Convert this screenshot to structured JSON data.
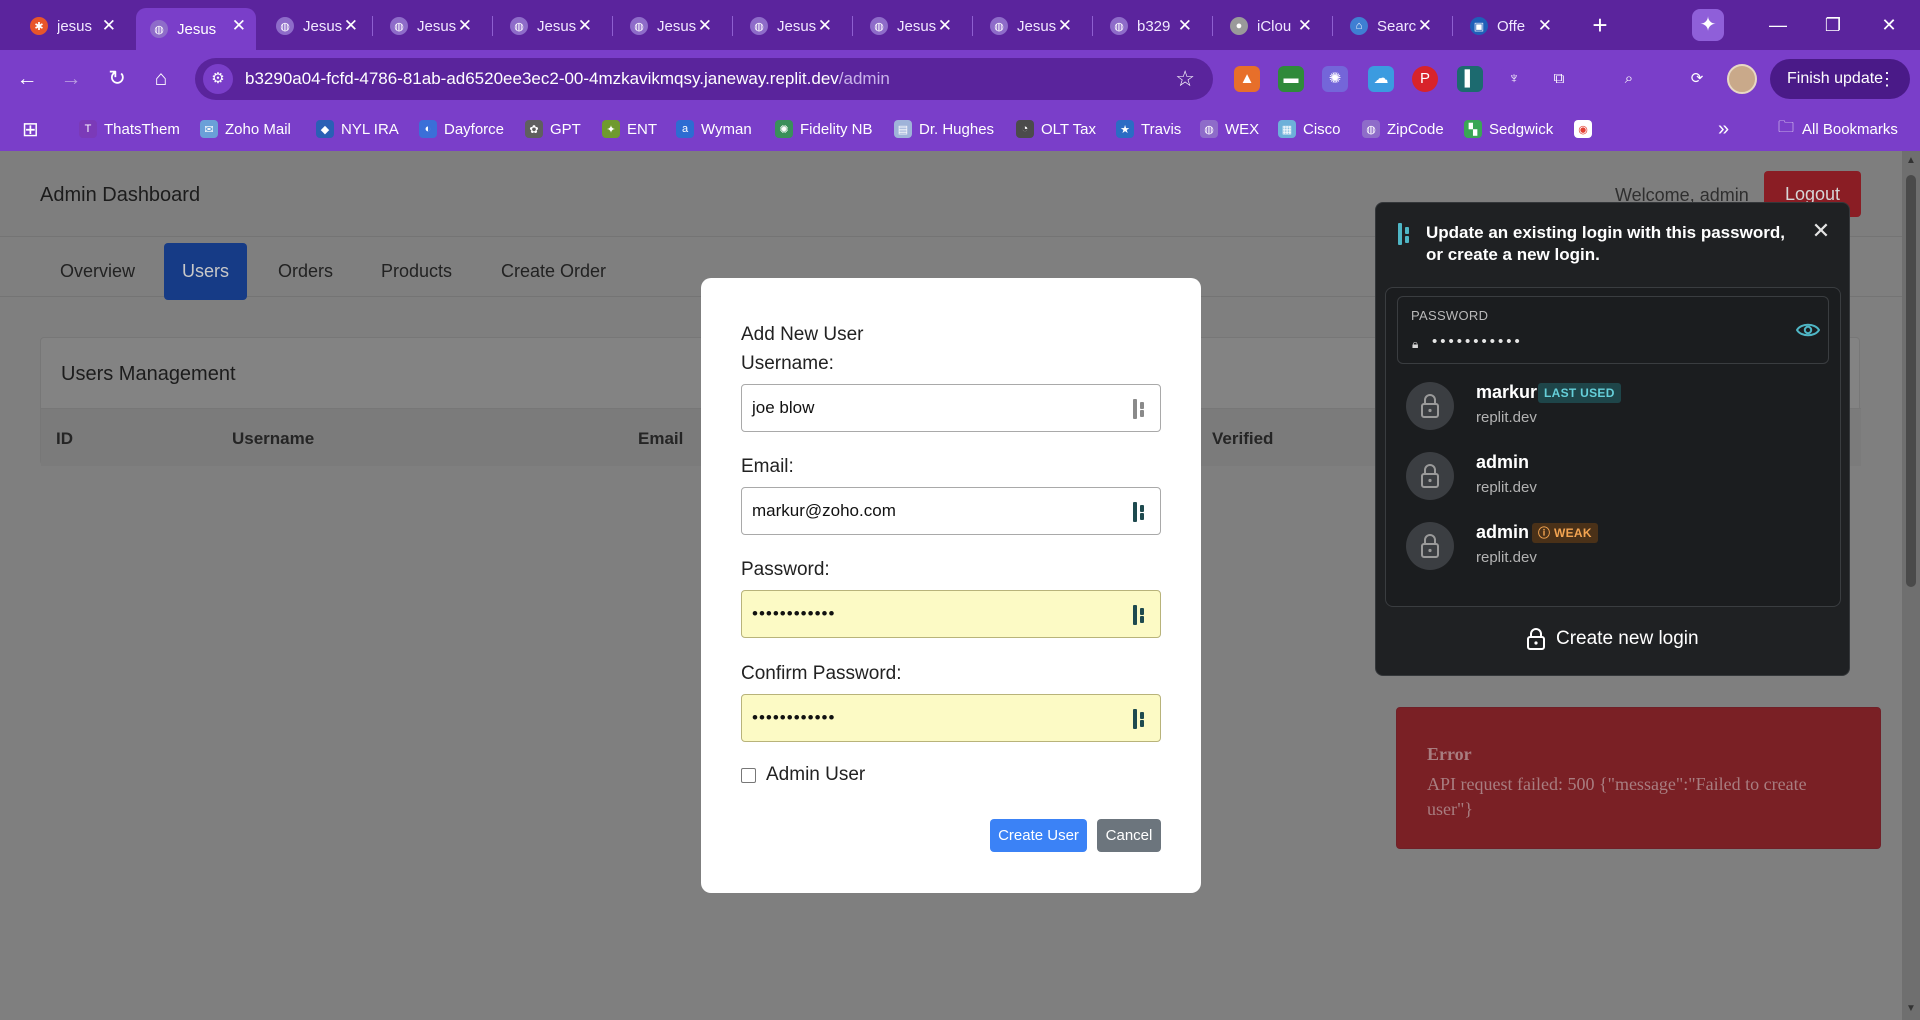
{
  "browser": {
    "tabs": [
      {
        "label": "jesus",
        "fav_color": "#e8552a",
        "fav_glyph": "✱"
      },
      {
        "label": "Jesus",
        "fav_color": "#8e6cc9",
        "fav_glyph": "◍"
      },
      {
        "label": "Jesus",
        "fav_color": "#8e6cc9",
        "fav_glyph": "◍"
      },
      {
        "label": "Jesus",
        "fav_color": "#8e6cc9",
        "fav_glyph": "◍"
      },
      {
        "label": "Jesus",
        "fav_color": "#8e6cc9",
        "fav_glyph": "◍"
      },
      {
        "label": "Jesus",
        "fav_color": "#8e6cc9",
        "fav_glyph": "◍"
      },
      {
        "label": "Jesus",
        "fav_color": "#8e6cc9",
        "fav_glyph": "◍"
      },
      {
        "label": "Jesus",
        "fav_color": "#8e6cc9",
        "fav_glyph": "◍"
      },
      {
        "label": "Jesus",
        "fav_color": "#8e6cc9",
        "fav_glyph": "◍"
      },
      {
        "label": "b329",
        "fav_color": "#8e6cc9",
        "fav_glyph": "◍"
      },
      {
        "label": "iClou",
        "fav_color": "#9a9a9a",
        "fav_glyph": "●"
      },
      {
        "label": "Searc",
        "fav_color": "#3f7fd3",
        "fav_glyph": "⌂"
      },
      {
        "label": "Offe",
        "fav_color": "#1f5fb8",
        "fav_glyph": "▣"
      }
    ],
    "url_host": "b3290a04-fcfd-4786-81ab-ad6520ee3ec2-00-4mzkavikmqsy.janeway.replit.dev",
    "url_path": "/admin",
    "finish_update": "Finish update",
    "bookmarks": [
      {
        "label": "ThatsThem",
        "color": "#7b3ab8",
        "glyph": "T"
      },
      {
        "label": "Zoho Mail",
        "color": "#6aa0d8",
        "glyph": "✉"
      },
      {
        "label": "NYL IRA",
        "color": "#2a5fb5",
        "glyph": "◆"
      },
      {
        "label": "Dayforce",
        "color": "#3b6fd8",
        "glyph": "◐"
      },
      {
        "label": "GPT",
        "color": "#5f5f5f",
        "glyph": "✿"
      },
      {
        "label": "ENT",
        "color": "#6f9a2e",
        "glyph": "✦"
      },
      {
        "label": "Wyman",
        "color": "#2d6cd2",
        "glyph": "a"
      },
      {
        "label": "Fidelity NB",
        "color": "#3a8f5a",
        "glyph": "✺"
      },
      {
        "label": "Dr. Hughes",
        "color": "#9fb3d9",
        "glyph": "▤"
      },
      {
        "label": "OLT Tax",
        "color": "#4b4b4b",
        "glyph": "◔"
      },
      {
        "label": "Travis",
        "color": "#2b6cc4",
        "glyph": "★"
      },
      {
        "label": "WEX",
        "color": "#8e6cc9",
        "glyph": "◍"
      },
      {
        "label": "Cisco",
        "color": "#6db0d9",
        "glyph": "▦"
      },
      {
        "label": "ZipCode",
        "color": "#8e6cc9",
        "glyph": "◍"
      },
      {
        "label": "Sedgwick",
        "color": "#3aa655",
        "glyph": "▚"
      }
    ],
    "all_bookmarks": "All Bookmarks"
  },
  "app": {
    "title": "Admin Dashboard",
    "welcome": "Welcome, admin",
    "logout": "Logout",
    "tabs": [
      "Overview",
      "Users",
      "Orders",
      "Products",
      "Create Order"
    ],
    "active_tab": "Users",
    "card_title": "Users Management",
    "columns": [
      "ID",
      "Username",
      "Email",
      "Verified"
    ]
  },
  "modal": {
    "title": "Add New User",
    "username_label": "Username:",
    "username_value": "joe blow",
    "email_label": "Email:",
    "email_value": "markur@zoho.com",
    "password_label": "Password:",
    "password_value": "••••••••••••",
    "confirm_label": "Confirm Password:",
    "confirm_value": "••••••••••••",
    "admin_label": "Admin User",
    "admin_checked": false,
    "create_button": "Create User",
    "cancel_button": "Cancel"
  },
  "password_popup": {
    "header": "Update an existing login with this password, or create a new login.",
    "field_label": "PASSWORD",
    "field_value": "•••••••••••",
    "credentials": [
      {
        "name": "markur",
        "domain": "replit.dev",
        "badge": "LAST USED",
        "badge_type": "last"
      },
      {
        "name": "admin",
        "domain": "replit.dev",
        "badge": "",
        "badge_type": ""
      },
      {
        "name": "admin",
        "domain": "replit.dev",
        "badge": "WEAK",
        "badge_type": "weak"
      }
    ],
    "create_new": "Create new login"
  },
  "error": {
    "title": "Error",
    "message": "API request failed: 500 {\"message\":\"Failed to create user\"}"
  }
}
